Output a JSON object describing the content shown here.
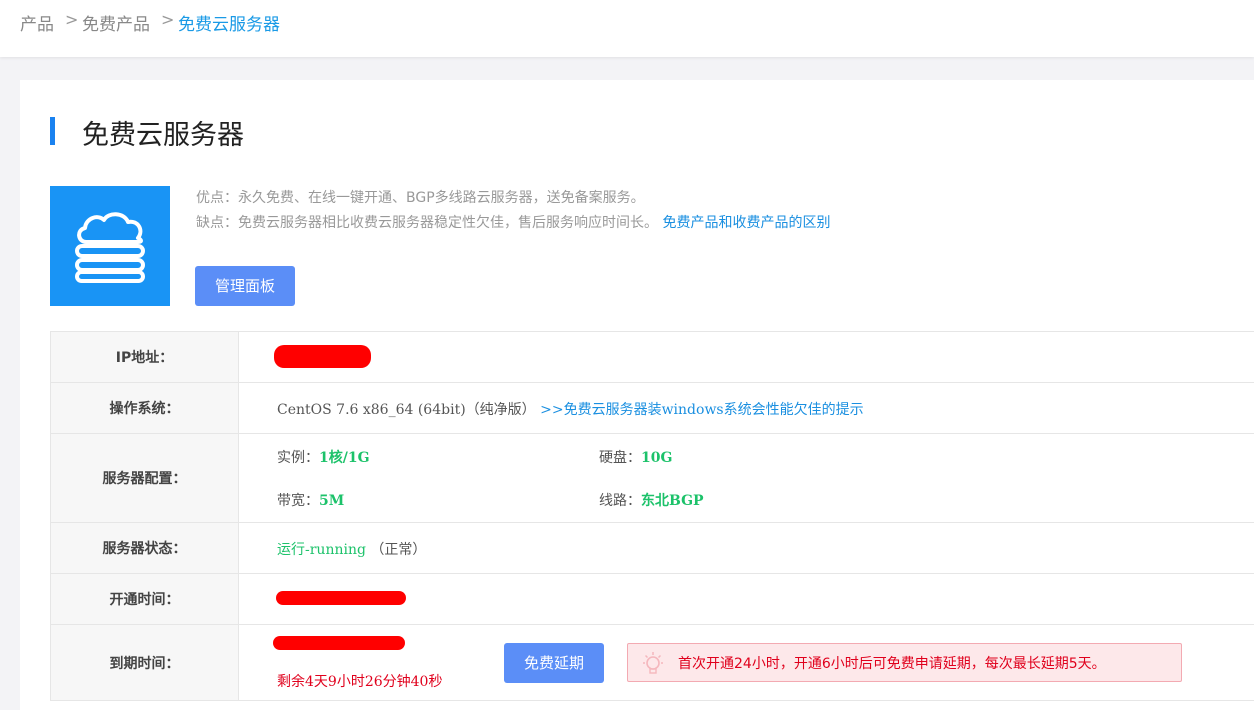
{
  "breadcrumb": {
    "items": [
      "产品",
      "免费产品",
      "免费云服务器"
    ],
    "separator": ">"
  },
  "page_title": "免费云服务器",
  "product_icon": "cloud-stack-icon",
  "description": {
    "pros": "优点：永久免费、在线一键开通、BGP多线路云服务器，送免备案服务。",
    "cons": "缺点：免费云服务器相比收费云服务器稳定性欠佳，售后服务响应时间长。",
    "cons_link": "免费产品和收费产品的区别"
  },
  "manage_button": "管理面板",
  "table": {
    "ip": {
      "label": "IP地址：",
      "value_redacted": true
    },
    "os": {
      "label": "操作系统：",
      "value": "CentOS 7.6 x86_64 (64bit)（纯净版）",
      "link": ">>免费云服务器装windows系统会性能欠佳的提示"
    },
    "config": {
      "label": "服务器配置：",
      "instance_label": "实例：",
      "instance_value": "1核/1G",
      "disk_label": "硬盘：",
      "disk_value": "10G",
      "bandwidth_label": "带宽：",
      "bandwidth_value": "5M",
      "line_label": "线路：",
      "line_value": "东北BGP"
    },
    "status": {
      "label": "服务器状态：",
      "value": "运行-running",
      "note": "（正常）"
    },
    "open_time": {
      "label": "开通时间：",
      "value_redacted": true
    },
    "expire_time": {
      "label": "到期时间：",
      "value_redacted": true,
      "remaining": "剩余4天9小时26分钟40秒",
      "extend_button": "免费延期",
      "notice_icon": "lightbulb-icon",
      "notice": "首次开通24小时，开通6小时后可免费申请延期，每次最长延期5天。"
    }
  },
  "colors": {
    "accent": "#1a9ae6",
    "button": "#5b8ef7",
    "icon_bg": "#1994f5",
    "success": "#1cc26a",
    "danger": "#e0001c",
    "redaction": "#ff0000"
  }
}
